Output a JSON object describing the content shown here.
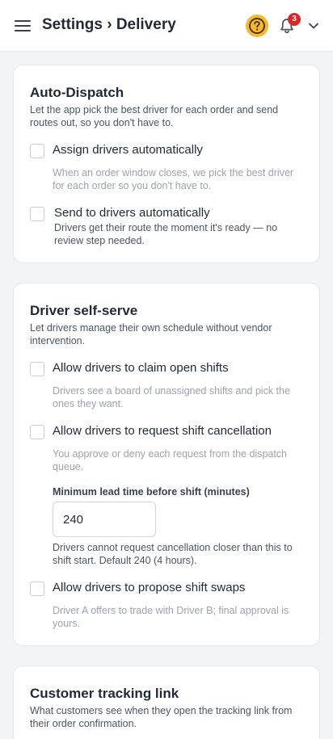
{
  "header": {
    "title": "Settings › Delivery",
    "help_icon": "question-circle-icon",
    "bell_icon": "bell-icon",
    "notification_count": "3",
    "chevron_icon": "chevron-down-icon",
    "help_color": "#f5b82e",
    "badge_color": "#dc2626"
  },
  "auto_dispatch": {
    "title": "Auto-Dispatch",
    "description": "Let the app pick the best driver for each order and send routes out, so you don't have to.",
    "options": [
      {
        "label": "Assign drivers automatically",
        "help": "When an order window closes, we pick the best driver for each order so you don't have to."
      },
      {
        "label": "Send to drivers automatically",
        "help": "Drivers get their route the moment it's ready — no review step needed."
      }
    ]
  },
  "driver_self_serve": {
    "title": "Driver self-serve",
    "description": "Let drivers manage their own schedule without vendor intervention.",
    "options": [
      {
        "label": "Allow drivers to claim open shifts",
        "help": "Drivers see a board of unassigned shifts and pick the ones they want."
      },
      {
        "label": "Allow drivers to request shift cancellation",
        "help": "You approve or deny each request from the dispatch queue."
      },
      {
        "label": "Allow drivers to propose shift swaps",
        "help": "Driver A offers to trade with Driver B; final approval is yours."
      }
    ],
    "lead_time": {
      "label": "Minimum lead time before shift (minutes)",
      "value": "240",
      "help": "Drivers cannot request cancellation closer than this to shift start. Default 240 (4 hours)."
    }
  },
  "customer_tracking": {
    "title": "Customer tracking link",
    "description": "What customers see when they open the tracking link from their order confirmation."
  }
}
